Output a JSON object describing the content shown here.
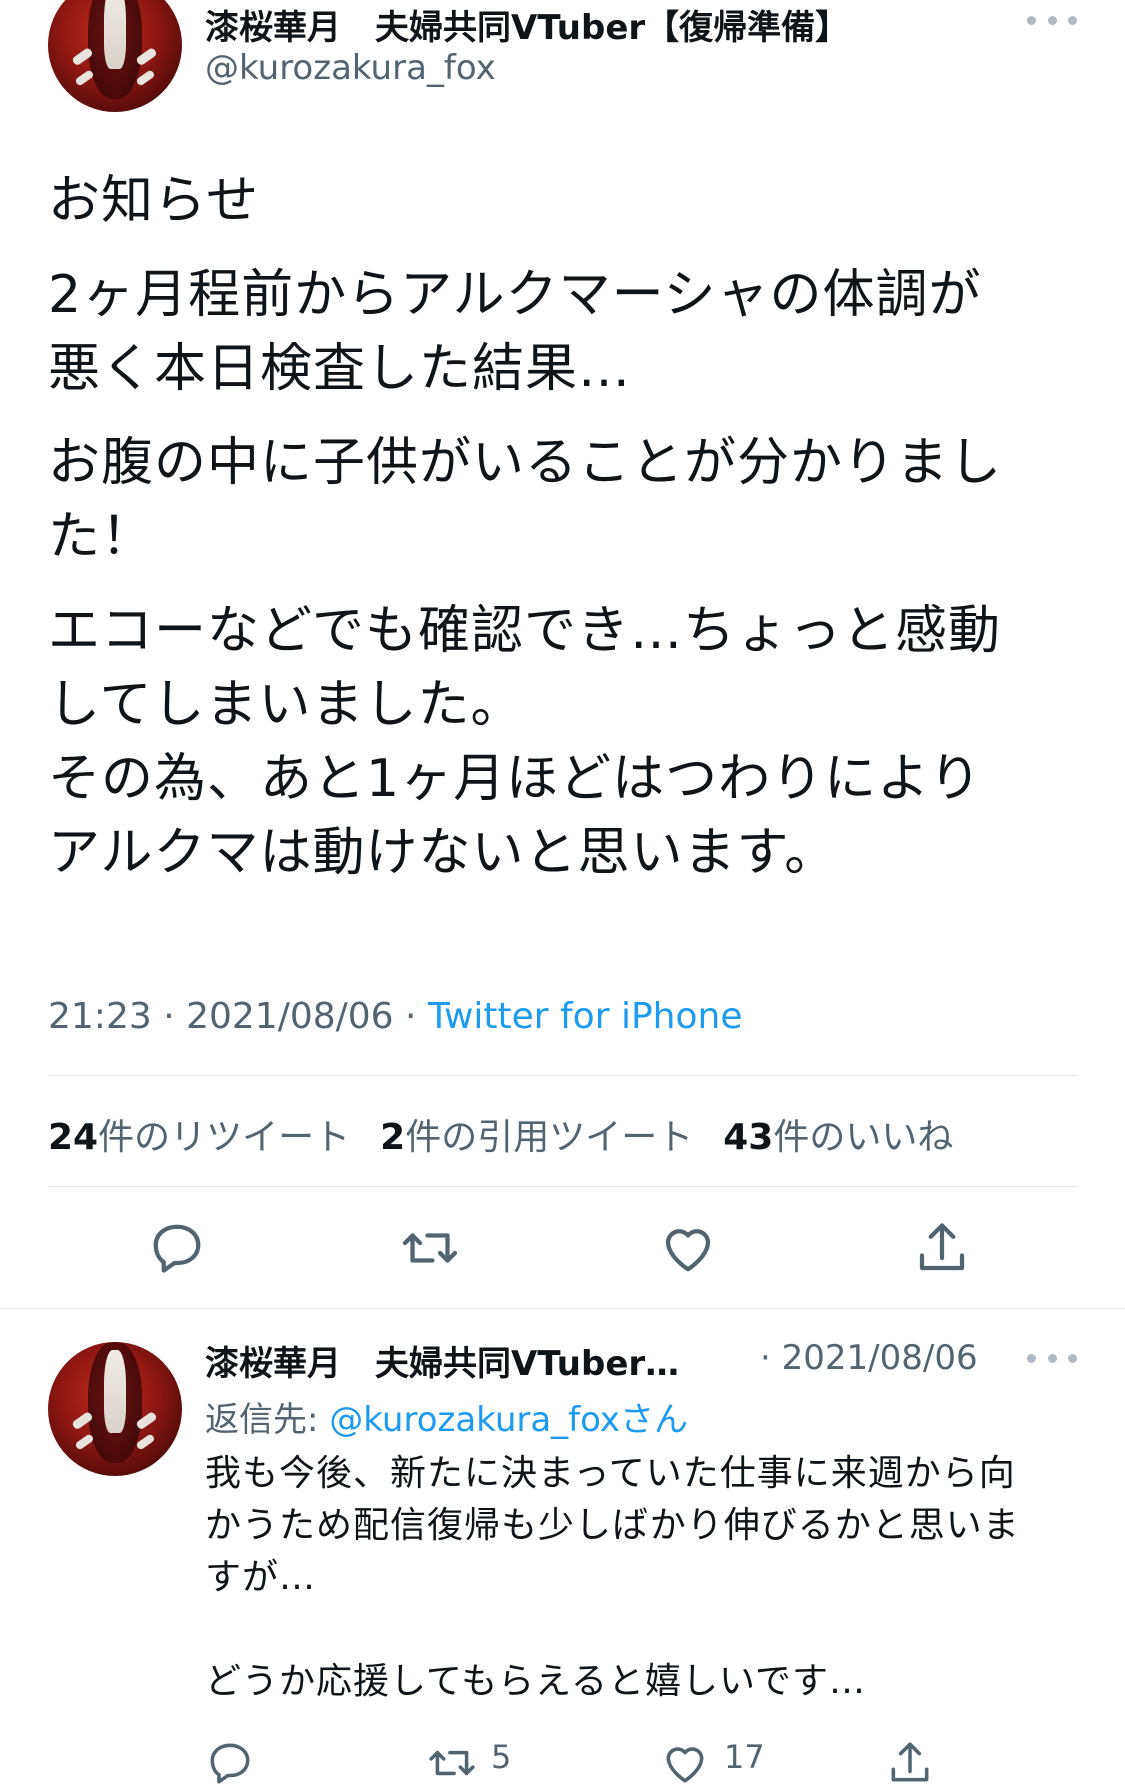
{
  "tweet": {
    "display_name": "漆桜華月　夫婦共同VTuber【復帰準備】",
    "handle": "@kurozakura_fox",
    "paragraphs": [
      "お知らせ",
      "2ヶ月程前からアルクマーシャの体調が\n悪く本日検査した結果…",
      "お腹の中に子供がいることが分かりまし\nた！",
      "エコーなどでも確認でき…ちょっと感動\nしてしまいました。",
      "その為、あと1ヶ月ほどはつわりにより\nアルクマは動けないと思います。"
    ],
    "time": "21:23 · 2021/08/06 · ",
    "source": "Twitter for iPhone"
  },
  "stats": {
    "retweets_count": "24",
    "retweets_label": "件のリツイート",
    "quotes_count": "2",
    "quotes_label": "件の引用ツイート",
    "likes_count": "43",
    "likes_label": "件のいいね"
  },
  "reply": {
    "display_name": "漆桜華月　夫婦共同VTuber…",
    "date": "· 2021/08/06",
    "reply_prefix": "返信先: ",
    "reply_mention": "@kurozakura_foxさん",
    "text": "我も今後、新たに決まっていた仕事に来週から向\nかうため配信復帰も少しばかり伸びるかと思いま\nすが…\n\nどうか応援してもらえると嬉しいです…",
    "retweet_count": "5",
    "like_count": "17"
  },
  "icons": {
    "more": "more-icon",
    "reply": "reply-icon",
    "retweet": "retweet-icon",
    "like": "heart-icon",
    "share": "share-icon"
  },
  "colors": {
    "link": "#1d9bf0",
    "secondary_text": "#536471",
    "primary_text": "#0f1419"
  }
}
